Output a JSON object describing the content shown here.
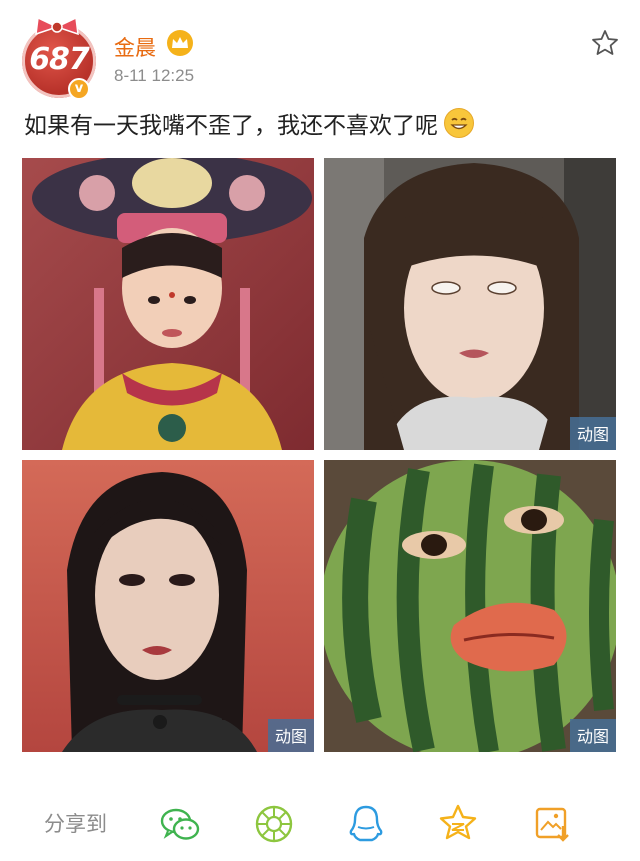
{
  "post": {
    "avatar_text": "687",
    "verified_mark": "v",
    "username": "金晨",
    "timestamp": "8-11 12:25",
    "text": "如果有一天我嘴不歪了，我还不喜欢了呢",
    "accent_color": "#e86b11"
  },
  "images": [
    {
      "name": "childhood-costume-photo",
      "gif": false
    },
    {
      "name": "eye-roll-selfie",
      "gif": true,
      "badge": "动图"
    },
    {
      "name": "stage-portrait",
      "gif": true,
      "badge": "动图"
    },
    {
      "name": "watermelon-face",
      "gif": true,
      "badge": "动图"
    }
  ],
  "share": {
    "label": "分享到",
    "targets": [
      "wechat-icon",
      "moments-icon",
      "qq-icon",
      "qzone-icon",
      "save-image-icon"
    ]
  }
}
